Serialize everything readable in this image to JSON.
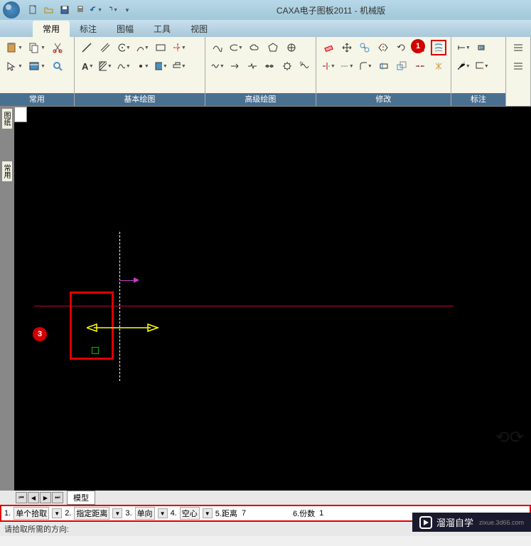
{
  "app": {
    "title": "CAXA电子图板2011 - 机械版"
  },
  "menu": {
    "items": [
      "常用",
      "标注",
      "图幅",
      "工具",
      "视图"
    ],
    "active_index": 0
  },
  "ribbon": {
    "panels": [
      {
        "label": "常用"
      },
      {
        "label": "基本绘图"
      },
      {
        "label": "高级绘图"
      },
      {
        "label": "修改"
      },
      {
        "label": "标注"
      }
    ]
  },
  "left_tabs": [
    "图纸",
    "常用"
  ],
  "bottom_tabs": {
    "sheet": "模型"
  },
  "option_bar": {
    "opt1_num": "1.",
    "opt1": "单个拾取",
    "opt2_num": "2.",
    "opt2": "指定距离",
    "opt3_num": "3.",
    "opt3": "单向",
    "opt4_num": "4.",
    "opt4": "空心",
    "opt5_label": "5.距离",
    "opt5_value": "7",
    "opt6_label": "6.份数",
    "opt6_value": "1"
  },
  "status": {
    "prompt": "请拾取所需的方向:"
  },
  "markers": {
    "m1": "1",
    "m3": "3"
  },
  "watermark": {
    "brand": "溜溜自学",
    "url": "zixue.3d66.com"
  }
}
